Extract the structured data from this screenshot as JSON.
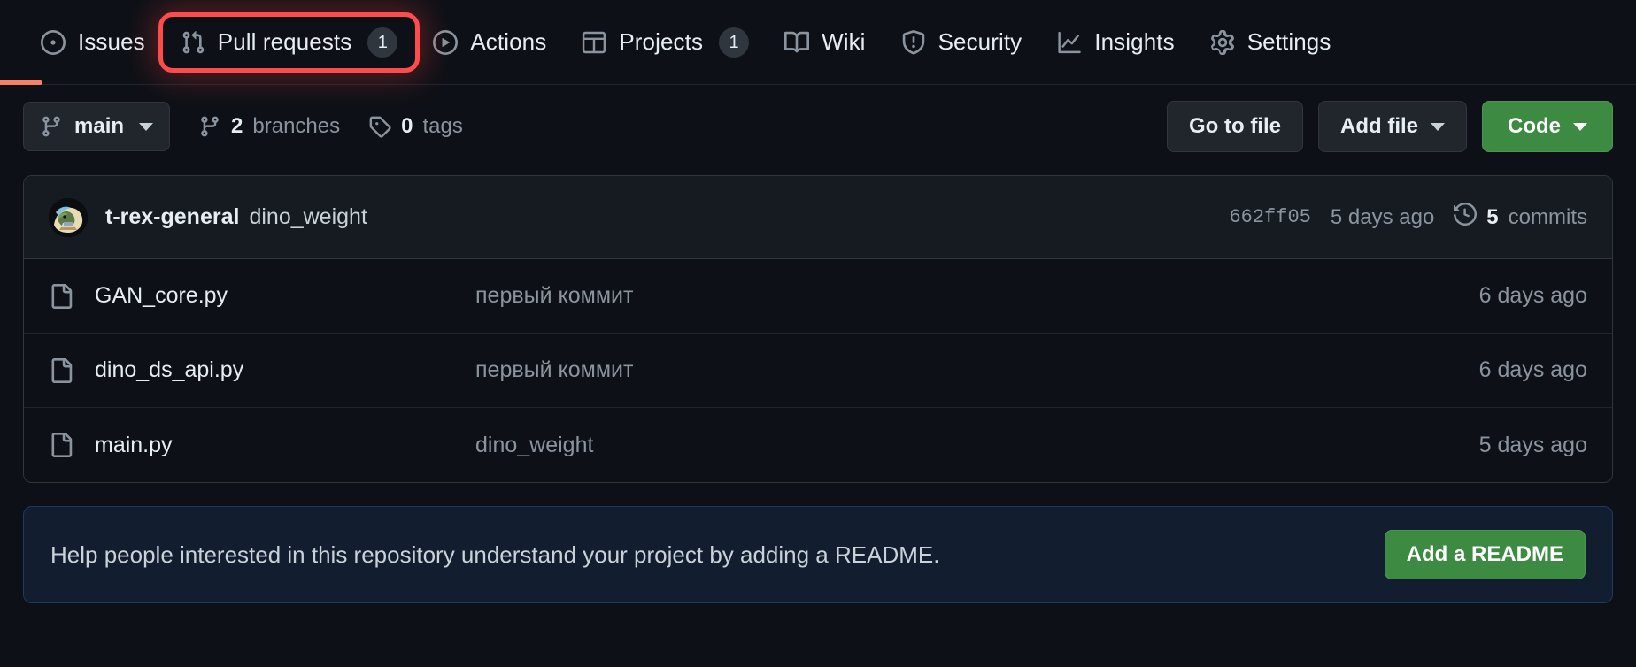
{
  "nav": {
    "items": [
      {
        "label": "Issues",
        "icon": "issue-opened-icon",
        "count": null,
        "highlighted": false
      },
      {
        "label": "Pull requests",
        "icon": "git-pull-request-icon",
        "count": "1",
        "highlighted": true
      },
      {
        "label": "Actions",
        "icon": "play-icon",
        "count": null,
        "highlighted": false
      },
      {
        "label": "Projects",
        "icon": "table-icon",
        "count": "1",
        "highlighted": false
      },
      {
        "label": "Wiki",
        "icon": "book-icon",
        "count": null,
        "highlighted": false
      },
      {
        "label": "Security",
        "icon": "shield-icon",
        "count": null,
        "highlighted": false
      },
      {
        "label": "Insights",
        "icon": "graph-icon",
        "count": null,
        "highlighted": false
      },
      {
        "label": "Settings",
        "icon": "gear-icon",
        "count": null,
        "highlighted": false
      }
    ],
    "highlight_color": "#ff4b4b",
    "active_underline_color": "#f78166"
  },
  "toolbar": {
    "branch": "main",
    "branches_count": "2",
    "branches_label": "branches",
    "tags_count": "0",
    "tags_label": "tags",
    "go_to_file": "Go to file",
    "add_file": "Add file",
    "code": "Code",
    "code_color": "#3d8b42"
  },
  "commit": {
    "author": "t-rex-general",
    "message": "dino_weight",
    "sha": "662ff05",
    "date": "5 days ago",
    "commits_count": "5",
    "commits_label": "commits"
  },
  "files": [
    {
      "name": "GAN_core.py",
      "commit": "первый коммит",
      "date": "6 days ago"
    },
    {
      "name": "dino_ds_api.py",
      "commit": "первый коммит",
      "date": "6 days ago"
    },
    {
      "name": "main.py",
      "commit": "dino_weight",
      "date": "5 days ago"
    }
  ],
  "readme": {
    "text": "Help people interested in this repository understand your project by adding a README.",
    "button": "Add a README",
    "button_color": "#3d8b42"
  }
}
